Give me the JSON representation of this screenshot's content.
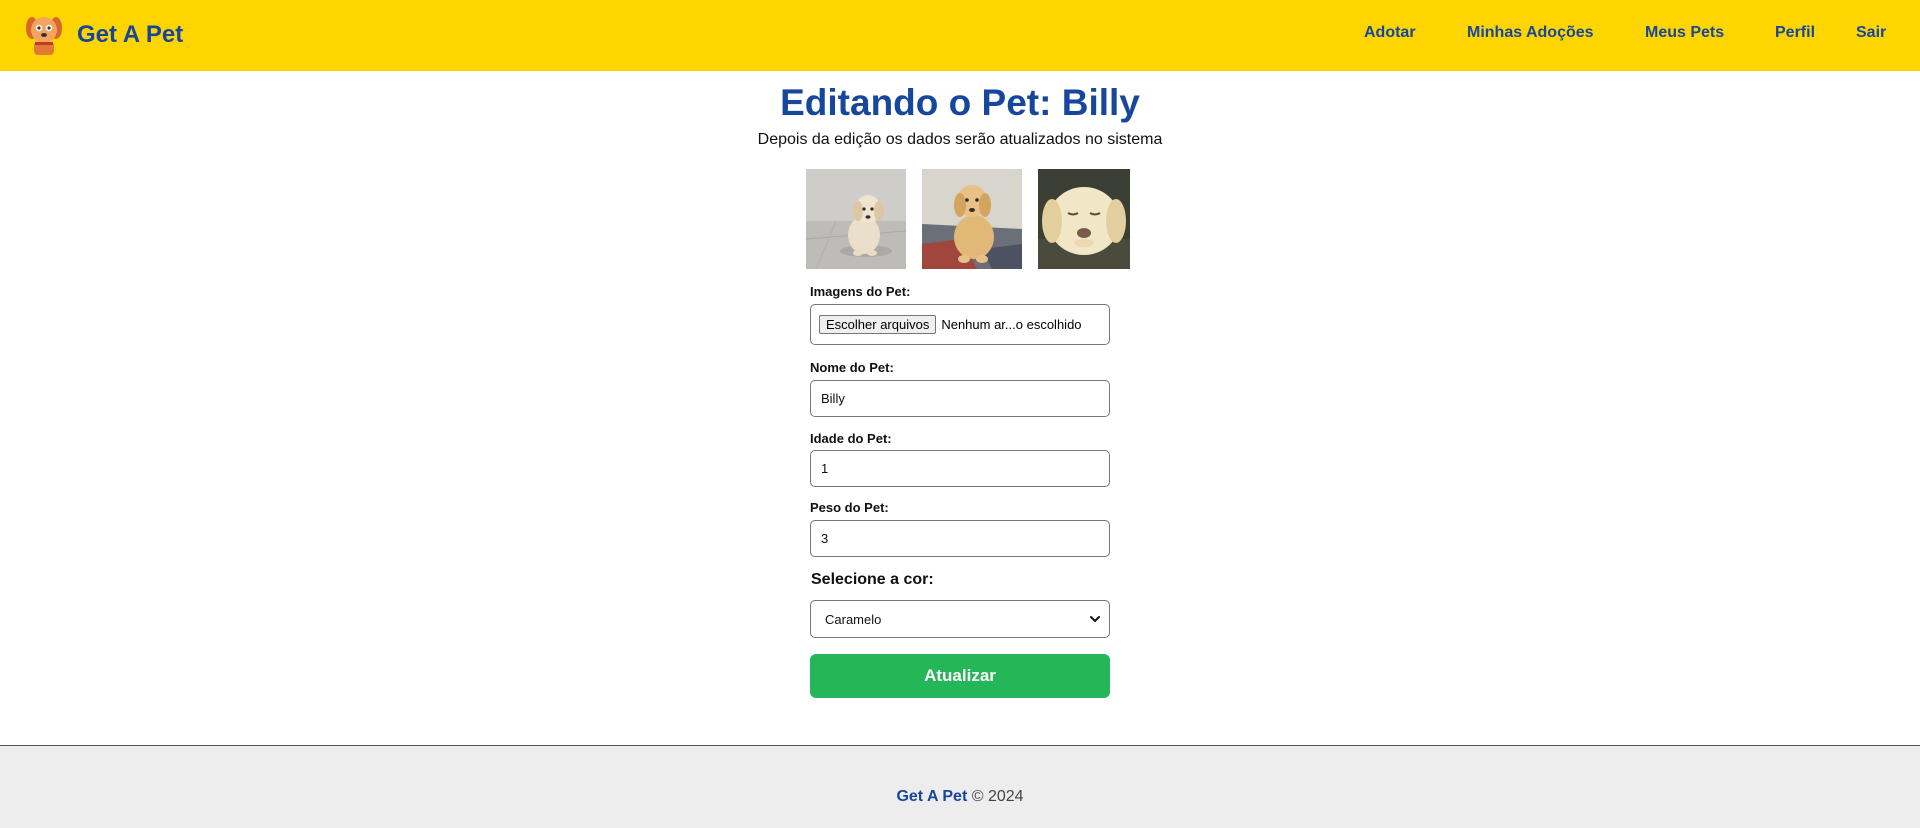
{
  "navbar": {
    "brand": "Get A Pet",
    "background_color": "#ffd500",
    "text_color": "#16479d",
    "links": [
      {
        "label": "Adotar"
      },
      {
        "label": "Minhas Adoções"
      },
      {
        "label": "Meus Pets"
      },
      {
        "label": "Perfil"
      },
      {
        "label": "Sair"
      }
    ]
  },
  "main": {
    "title": "Editando o Pet: Billy",
    "subtitle": "Depois da edição os dados serão atualizados no sistema",
    "photos": [
      {
        "icon": "puppy-photo-1"
      },
      {
        "icon": "puppy-photo-2"
      },
      {
        "icon": "puppy-photo-3"
      }
    ]
  },
  "form": {
    "images_label": "Imagens do Pet:",
    "file_button": "Escolher arquivos",
    "file_status": "Nenhum ar...o escolhido",
    "name_label": "Nome do Pet:",
    "name_value": "Billy",
    "age_label": "Idade do Pet:",
    "age_value": "1",
    "weight_label": "Peso do Pet:",
    "weight_value": "3",
    "color_label": "Selecione a cor:",
    "color_value": "Caramelo",
    "submit_label": "Atualizar",
    "submit_color": "#25b659"
  },
  "footer": {
    "brand": "Get A Pet",
    "copyright": "© 2024",
    "background_color": "#ededed"
  }
}
